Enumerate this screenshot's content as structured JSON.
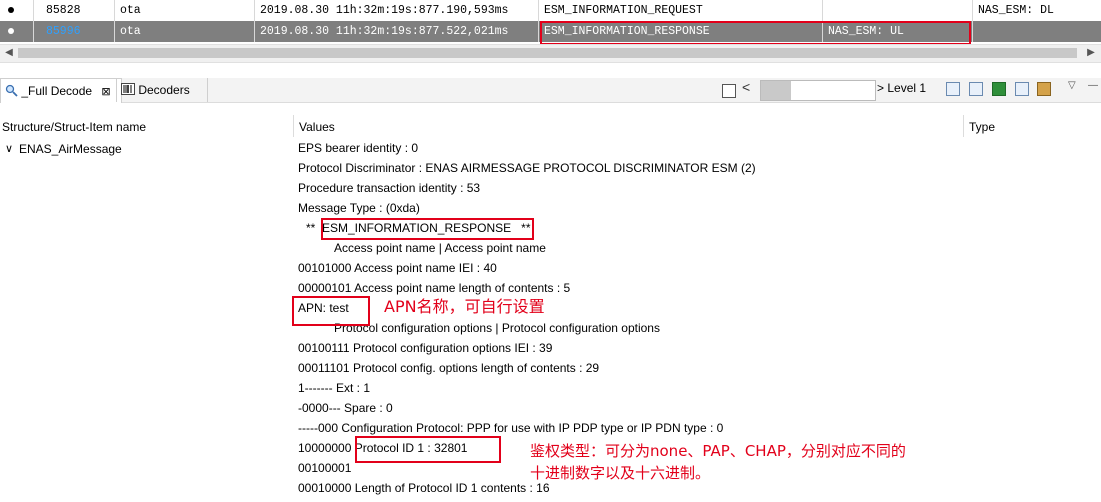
{
  "messages": [
    {
      "index": "85828",
      "source": "ota",
      "timestamp": "2019.08.30 11h:32m:19s:877.190,593ms",
      "name": "ESM_INFORMATION_REQUEST",
      "channel": "",
      "direction": "NAS_ESM: DL"
    },
    {
      "index": "85996",
      "source": "ota",
      "timestamp": "2019.08.30 11h:32m:19s:877.522,021ms",
      "name": "ESM_INFORMATION_RESPONSE",
      "channel": "NAS_ESM: UL",
      "direction": ""
    }
  ],
  "scroll": {
    "left_arrow": "◀",
    "right_arrow": "▶"
  },
  "tabs": {
    "full_decode": "_Full Decode",
    "full_decode_close": "⊠",
    "decoders": "Decoders"
  },
  "toolbar": {
    "checkbox_chevron": "<",
    "level_chevron": ">",
    "level_label": "Level 1",
    "menu_triangle": "▽",
    "minimize": "—"
  },
  "tree": {
    "headers": {
      "name": "Structure/Struct-Item name",
      "values": "Values",
      "type": "Type"
    },
    "root_expander": "∨",
    "root": "ENAS_AirMessage",
    "values": [
      "EPS bearer identity : 0",
      "Protocol Discriminator : ENAS AIRMESSAGE PROTOCOL DISCRIMINATOR ESM (2)",
      "Procedure transaction identity : 53",
      "Message Type : (0xda)",
      "**  ESM_INFORMATION_RESPONSE   **",
      "Access point name | Access point name",
      "00101000 Access point name IEI : 40",
      "00000101 Access point name length of contents : 5",
      "APN: test",
      "Protocol configuration options | Protocol configuration options",
      "00100111 Protocol configuration options IEI : 39",
      "00011101 Protocol config. options length of contents : 29",
      "1------- Ext : 1",
      "-0000--- Spare : 0",
      "-----000 Configuration Protocol: PPP for use with IP PDP type or IP PDN type : 0",
      "10000000 Protocol ID 1 : 32801",
      "00100001",
      "00010000 Length of Protocol ID 1 contents : 16"
    ]
  },
  "annotations": {
    "apn_note": "APN名称，可自行设置",
    "auth_note_line1": "鉴权类型：可分为none、PAP、CHAP，分别对应不同的",
    "auth_note_line2": "十进制数字以及十六进制。"
  },
  "colors": {
    "selected_row": "#7f7f7f",
    "highlight_box": "#e2001a",
    "index_link": "#2ea0ff"
  }
}
